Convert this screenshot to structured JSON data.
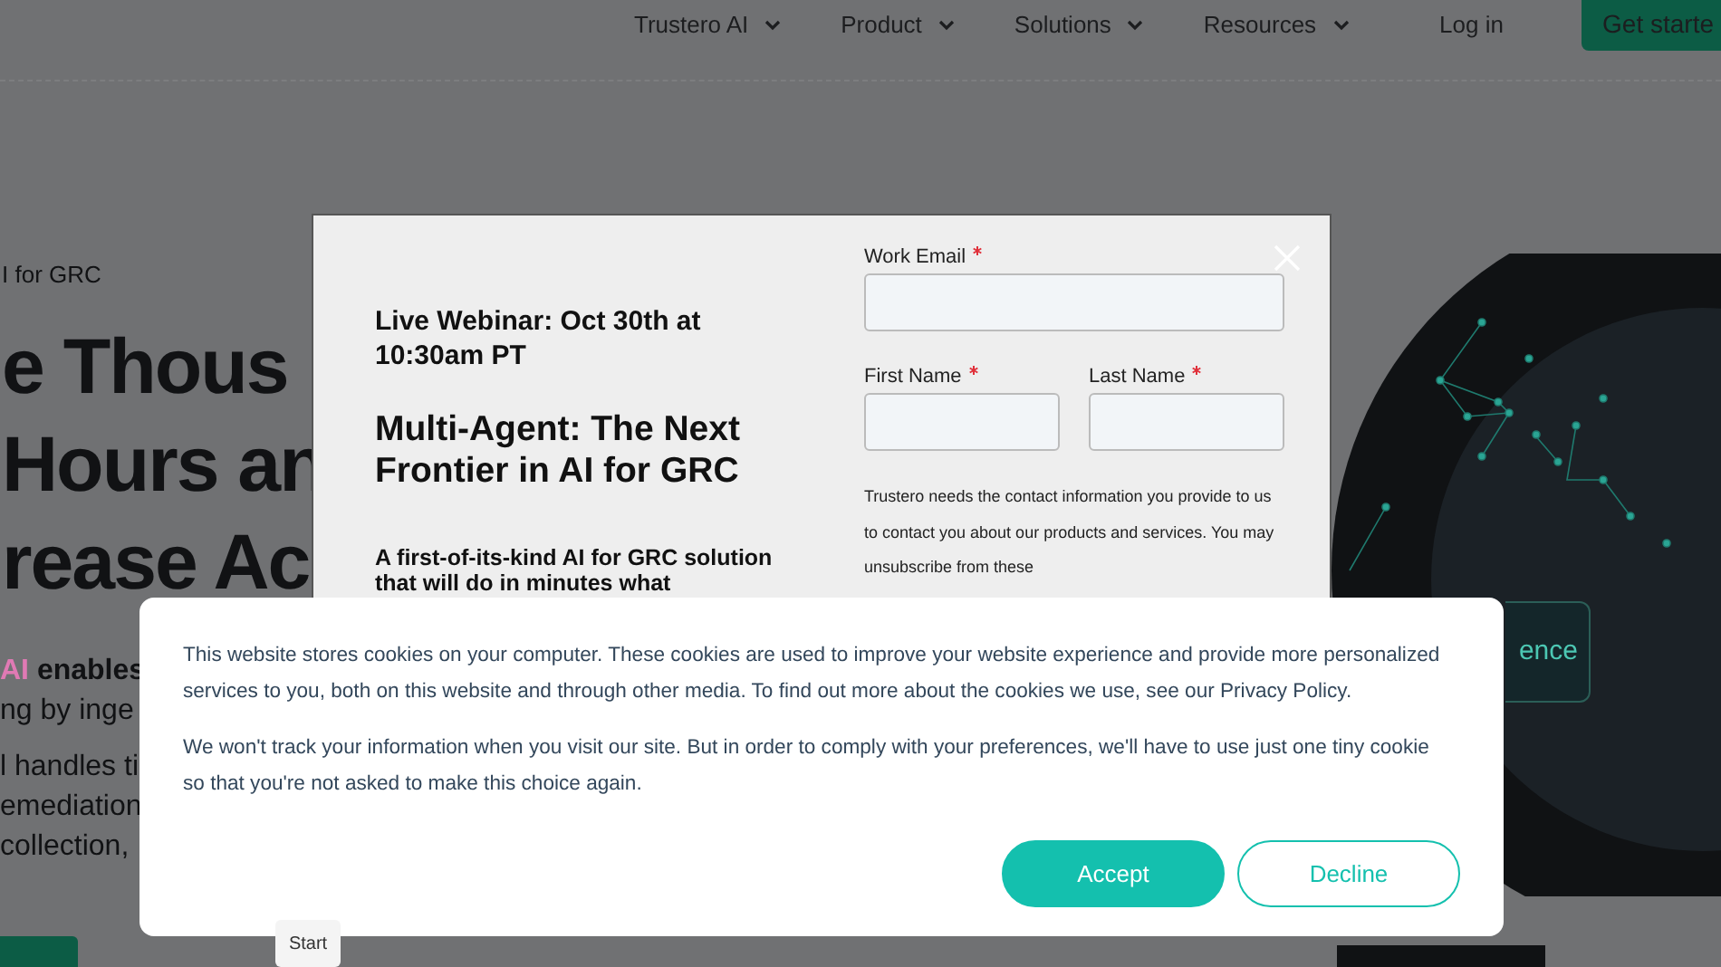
{
  "nav": {
    "items": [
      {
        "label": "Trustero AI"
      },
      {
        "label": "Product"
      },
      {
        "label": "Solutions"
      },
      {
        "label": "Resources"
      }
    ],
    "login": "Log in",
    "cta": "Get starte"
  },
  "hero": {
    "eyebrow": "I for GRC",
    "headline": [
      "e Thous",
      "Hours an",
      "rease Ac"
    ],
    "body": [
      {
        "highlight": "AI",
        "rest": "enables"
      },
      {
        "rest": "ng by inge"
      },
      {
        "rest": "l handles ti"
      },
      {
        "rest": "emediation"
      },
      {
        "rest": "collection,"
      }
    ],
    "side_button": "ence"
  },
  "webinar_modal": {
    "date": "Live Webinar: Oct 30th at 10:30am PT",
    "title": "Multi-Agent: The Next Frontier in AI for GRC",
    "lead": "A first-of-its-kind AI for GRC solution that will do in minutes what",
    "fields": [
      {
        "label": "Work Email",
        "required": true
      },
      {
        "label": "First Name",
        "required": true
      },
      {
        "label": "Last Name",
        "required": true
      }
    ],
    "consent": "Trustero needs the contact information you provide to us to contact you about our products and services. You may unsubscribe from these"
  },
  "cookie_banner": {
    "paragraphs": [
      "This website stores cookies on your computer. These cookies are used to improve your website experience and provide more personalized services to you, both on this website and through other media. To find out more about the cookies we use, see our Privacy Policy.",
      "We won't track your information when you visit our site. But in order to comply with your preferences, we'll have to use just one tiny cookie so that you're not asked to make this choice again."
    ],
    "buttons": [
      {
        "label": "Accept",
        "kind": "primary"
      },
      {
        "label": "Decline",
        "kind": "secondary"
      }
    ]
  },
  "tooltip": "Start"
}
